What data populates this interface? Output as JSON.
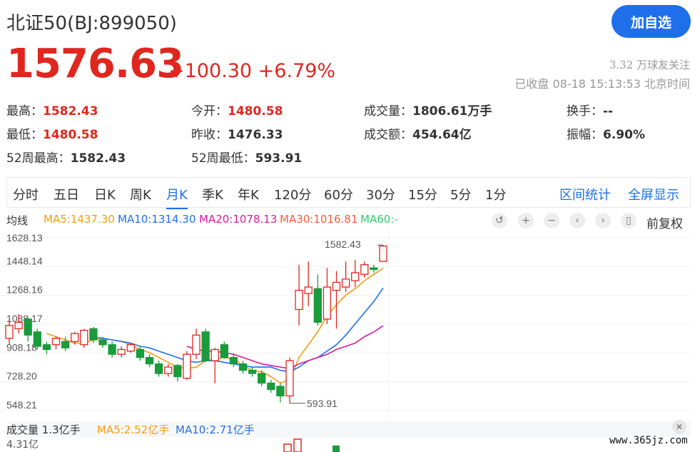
{
  "header": {
    "title": "北证50(BJ:899050)",
    "follow_label": "加自选",
    "price": "1576.63",
    "change": "+100.30 +6.79%",
    "followers": "3.32 万球友关注",
    "status": "已收盘 08-18 15:13:53 北京时间"
  },
  "stats": [
    {
      "label": "最高：",
      "value": "1582.43",
      "color": "red"
    },
    {
      "label": "今开：",
      "value": "1480.58",
      "color": "red"
    },
    {
      "label": "成交量：",
      "value": "1806.61万手",
      "color": ""
    },
    {
      "label": "换手：",
      "value": "--",
      "color": ""
    },
    {
      "label": "最低：",
      "value": "1480.58",
      "color": "red"
    },
    {
      "label": "昨收：",
      "value": "1476.33",
      "color": ""
    },
    {
      "label": "成交额：",
      "value": "454.64亿",
      "color": ""
    },
    {
      "label": "振幅：",
      "value": "6.90%",
      "color": ""
    },
    {
      "label": "52周最高：",
      "value": "1582.43",
      "color": ""
    },
    {
      "label": "52周最低：",
      "value": "593.91",
      "color": ""
    }
  ],
  "tabs": [
    "分时",
    "五日",
    "日K",
    "周K",
    "月K",
    "季K",
    "年K",
    "120分",
    "60分",
    "30分",
    "15分",
    "5分",
    "1分"
  ],
  "active_tab": 4,
  "tab_right": [
    "区间统计",
    "全屏显示"
  ],
  "ma": {
    "label": "均线",
    "items": [
      {
        "text": "MA5:1437.30",
        "color": "#f39c12"
      },
      {
        "text": "MA10:1314.30",
        "color": "#1f6feb"
      },
      {
        "text": "MA20:1078.13",
        "color": "#d81b9c"
      },
      {
        "text": "MA30:1016.81",
        "color": "#ff5a3c"
      },
      {
        "text": "MA60:-",
        "color": "#2ecc71"
      }
    ]
  },
  "controls": [
    "↺",
    "+",
    "−",
    "‹",
    "›",
    "▯"
  ],
  "fuquan": "前复权",
  "volume": {
    "label": "成交量 1.3亿手",
    "ma5": "MA5:2.52亿手",
    "ma10": "MA10:2.71亿手",
    "axis_top": "4.31亿",
    "ma5_color": "#f39c12",
    "ma10_color": "#1f6feb"
  },
  "chart_data": {
    "type": "candlestick",
    "y_ticks": [
      "1628.13",
      "1448.14",
      "1268.16",
      "1088.17",
      "908.18",
      "728.20",
      "548.21"
    ],
    "ylim": [
      548.21,
      1628.13
    ],
    "high_label": "1582.43",
    "low_label": "593.91",
    "candles": [
      [
        1000,
        1080,
        960,
        1120
      ],
      [
        1060,
        1100,
        1030,
        1150
      ],
      [
        1120,
        1020,
        980,
        1130
      ],
      [
        1040,
        950,
        930,
        1060
      ],
      [
        960,
        930,
        900,
        980
      ],
      [
        960,
        1000,
        930,
        1010
      ],
      [
        980,
        940,
        920,
        1010
      ],
      [
        980,
        1030,
        960,
        1040
      ],
      [
        960,
        1050,
        940,
        1060
      ],
      [
        1060,
        990,
        970,
        1070
      ],
      [
        990,
        960,
        940,
        1010
      ],
      [
        960,
        900,
        880,
        980
      ],
      [
        900,
        930,
        880,
        950
      ],
      [
        920,
        960,
        910,
        970
      ],
      [
        930,
        880,
        860,
        950
      ],
      [
        880,
        840,
        820,
        900
      ],
      [
        840,
        780,
        760,
        860
      ],
      [
        780,
        820,
        760,
        840
      ],
      [
        830,
        760,
        730,
        840
      ],
      [
        750,
        900,
        740,
        920
      ],
      [
        900,
        1020,
        870,
        1060
      ],
      [
        1040,
        860,
        850,
        1060
      ],
      [
        860,
        930,
        720,
        940
      ],
      [
        960,
        880,
        870,
        980
      ],
      [
        880,
        840,
        820,
        900
      ],
      [
        840,
        800,
        780,
        860
      ],
      [
        800,
        780,
        760,
        820
      ],
      [
        780,
        720,
        700,
        800
      ],
      [
        720,
        680,
        660,
        740
      ],
      [
        700,
        640,
        600,
        720
      ],
      [
        640,
        860,
        593.91,
        880
      ],
      [
        1180,
        1300,
        1080,
        1460
      ],
      [
        1280,
        1320,
        1200,
        1480
      ],
      [
        1310,
        1100,
        1080,
        1400
      ],
      [
        1120,
        1320,
        1090,
        1440
      ],
      [
        1300,
        1350,
        1060,
        1420
      ],
      [
        1320,
        1370,
        1290,
        1480
      ],
      [
        1360,
        1410,
        1320,
        1490
      ],
      [
        1400,
        1460,
        1380,
        1480
      ],
      [
        1440,
        1430,
        1410,
        1460
      ],
      [
        1480.58,
        1576.63,
        1480.58,
        1582.43
      ]
    ],
    "ma5": [
      null,
      null,
      null,
      null,
      1030,
      1010,
      990,
      970,
      970,
      990,
      1000,
      990,
      980,
      960,
      930,
      910,
      880,
      850,
      820,
      810,
      820,
      860,
      870,
      880,
      870,
      830,
      800,
      790,
      760,
      720,
      740,
      880,
      960,
      1040,
      1140,
      1210,
      1270,
      1310,
      1360,
      1400,
      1437.3
    ],
    "ma10": [
      null,
      null,
      null,
      null,
      null,
      null,
      null,
      null,
      null,
      1010,
      1000,
      990,
      980,
      970,
      950,
      940,
      920,
      900,
      880,
      860,
      850,
      860,
      860,
      850,
      840,
      830,
      820,
      820,
      820,
      800,
      790,
      820,
      860,
      880,
      920,
      960,
      1020,
      1090,
      1160,
      1230,
      1314.3
    ],
    "ma20": [
      null,
      null,
      null,
      null,
      null,
      null,
      null,
      null,
      null,
      null,
      null,
      null,
      null,
      null,
      null,
      null,
      null,
      null,
      null,
      950,
      930,
      920,
      920,
      910,
      900,
      880,
      860,
      840,
      830,
      820,
      810,
      840,
      860,
      880,
      900,
      930,
      950,
      970,
      1010,
      1040,
      1078.13
    ]
  }
}
